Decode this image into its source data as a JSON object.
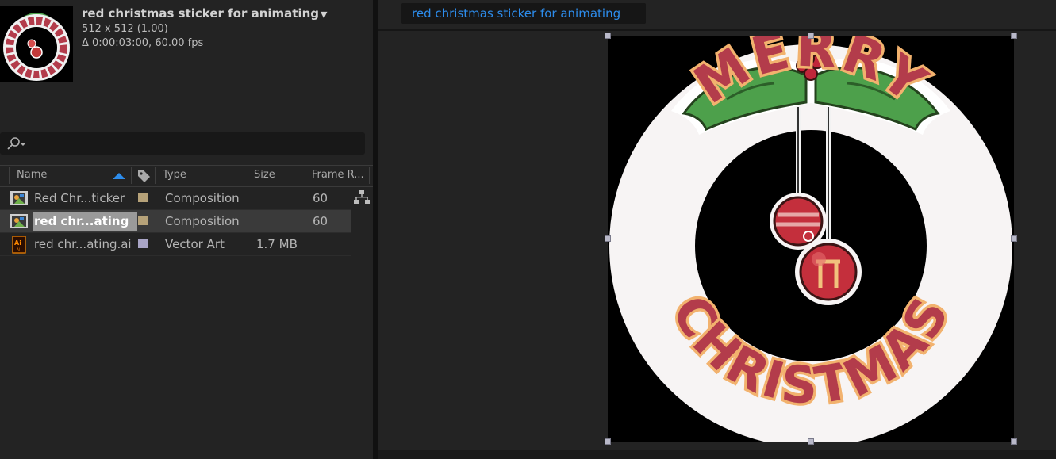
{
  "project": {
    "comp_title": "red christmas sticker for animating",
    "dimensions": "512 x 512 (1.00)",
    "duration": "Δ 0:00:03:00, 60.00 fps",
    "search_placeholder": ""
  },
  "columns": {
    "name": "Name",
    "type": "Type",
    "size": "Size",
    "frame_rate": "Frame R..."
  },
  "items": [
    {
      "name": "Red Chr...ticker",
      "type": "Composition",
      "size": "",
      "fps": "60",
      "swatch": "#b6a279",
      "icon": "composition-icon"
    },
    {
      "name": "red chr...ating",
      "type": "Composition",
      "size": "",
      "fps": "60",
      "swatch": "#b6a279",
      "icon": "composition-icon"
    },
    {
      "name": "red chr...ating.ai",
      "type": "Vector Art",
      "size": "1.7 MB",
      "fps": "",
      "swatch": "#a9a5c6",
      "icon": "illustrator-file-icon"
    }
  ],
  "viewer": {
    "tab_label": "red christmas sticker for animating"
  },
  "artwork": {
    "line1": "MERRY",
    "line2": "CHRISTMAS"
  },
  "colors": {
    "accent": "#2d8ceb",
    "letter_fill": "#b33c4b",
    "letter_outline": "#f2b26e",
    "holly": "#4da04b"
  }
}
